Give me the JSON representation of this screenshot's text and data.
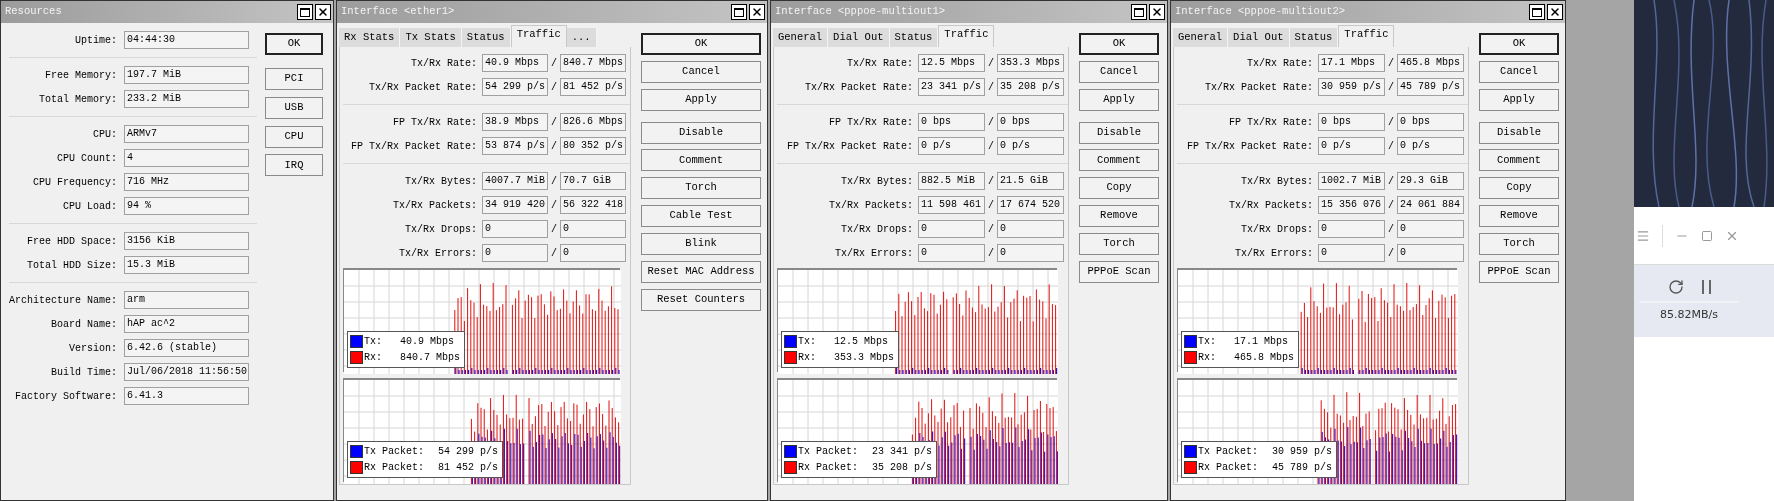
{
  "resources": {
    "title": "Resources",
    "groups": [
      [
        {
          "label": "Uptime:",
          "value": "04:44:30"
        }
      ],
      [
        {
          "label": "Free Memory:",
          "value": "197.7 MiB"
        },
        {
          "label": "Total Memory:",
          "value": "233.2 MiB"
        }
      ],
      [
        {
          "label": "CPU:",
          "value": "ARMv7"
        },
        {
          "label": "CPU Count:",
          "value": "4"
        },
        {
          "label": "CPU Frequency:",
          "value": "716 MHz"
        },
        {
          "label": "CPU Load:",
          "value": "94 %"
        }
      ],
      [
        {
          "label": "Free HDD Space:",
          "value": "3156 KiB"
        },
        {
          "label": "Total HDD Size:",
          "value": "15.3 MiB"
        }
      ],
      [
        {
          "label": "Architecture Name:",
          "value": "arm"
        },
        {
          "label": "Board Name:",
          "value": "hAP ac^2"
        },
        {
          "label": "Version:",
          "value": "6.42.6 (stable)"
        },
        {
          "label": "Build Time:",
          "value": "Jul/06/2018 11:56:50"
        },
        {
          "label": "Factory Software:",
          "value": "6.41.3"
        }
      ]
    ],
    "buttons": [
      {
        "label": "OK",
        "default": true
      },
      {
        "label": "PCI",
        "default": false
      },
      {
        "label": "USB",
        "default": false
      },
      {
        "label": "CPU",
        "default": false
      },
      {
        "label": "IRQ",
        "default": false
      }
    ]
  },
  "interfaces": [
    {
      "title": "Interface <ether1>",
      "tabs": [
        {
          "label": "Rx Stats",
          "selected": false
        },
        {
          "label": "Tx Stats",
          "selected": false
        },
        {
          "label": "Status",
          "selected": false
        },
        {
          "label": "Traffic",
          "selected": true
        },
        {
          "label": "...",
          "selected": false
        }
      ],
      "groups": [
        [
          {
            "label": "Tx/Rx Rate:",
            "tx": "40.9 Mbps",
            "sep": "/",
            "rx": "840.7 Mbps"
          },
          {
            "label": "Tx/Rx Packet Rate:",
            "tx": "54 299 p/s",
            "sep": "/",
            "rx": "81 452 p/s"
          }
        ],
        [
          {
            "label": "FP Tx/Rx Rate:",
            "tx": "38.9 Mbps",
            "sep": "/",
            "rx": "826.6 Mbps"
          },
          {
            "label": "FP Tx/Rx Packet Rate:",
            "tx": "53 874 p/s",
            "sep": "/",
            "rx": "80 352 p/s"
          }
        ],
        [
          {
            "label": "Tx/Rx Bytes:",
            "tx": "4007.7 MiB",
            "sep": "/",
            "rx": "70.7 GiB"
          },
          {
            "label": "Tx/Rx Packets:",
            "tx": "34 919 420",
            "sep": "/",
            "rx": "56 322 418"
          },
          {
            "label": "Tx/Rx Drops:",
            "tx": "0",
            "sep": "/",
            "rx": "0"
          },
          {
            "label": "Tx/Rx Errors:",
            "tx": "0",
            "sep": "/",
            "rx": "0"
          }
        ]
      ],
      "buttons": [
        {
          "label": "OK",
          "default": true
        },
        {
          "label": "Cancel",
          "default": false
        },
        {
          "label": "Apply",
          "default": false
        },
        {
          "label": "Disable",
          "default": false
        },
        {
          "label": "Comment",
          "default": false
        },
        {
          "label": "Torch",
          "default": false
        },
        {
          "label": "Cable Test",
          "default": false
        },
        {
          "label": "Blink",
          "default": false
        },
        {
          "label": "Reset MAC Address",
          "default": false
        },
        {
          "label": "Reset Counters",
          "default": false
        }
      ],
      "rate_graph": {
        "legend": [
          {
            "label": "Tx:",
            "value": "40.9 Mbps",
            "color": "#0000ff"
          },
          {
            "label": "Rx:",
            "value": "840.7 Mbps",
            "color": "#ff0000"
          }
        ]
      },
      "packet_graph": {
        "legend": [
          {
            "label": "Tx Packet:",
            "value": "54 299 p/s",
            "color": "#0000ff"
          },
          {
            "label": "Rx Packet:",
            "value": "81 452 p/s",
            "color": "#ff0000"
          }
        ]
      }
    },
    {
      "title": "Interface <pppoe-multiout1>",
      "tabs": [
        {
          "label": "General",
          "selected": false
        },
        {
          "label": "Dial Out",
          "selected": false
        },
        {
          "label": "Status",
          "selected": false
        },
        {
          "label": "Traffic",
          "selected": true
        }
      ],
      "groups": [
        [
          {
            "label": "Tx/Rx Rate:",
            "tx": "12.5 Mbps",
            "sep": "/",
            "rx": "353.3 Mbps"
          },
          {
            "label": "Tx/Rx Packet Rate:",
            "tx": "23 341 p/s",
            "sep": "/",
            "rx": "35 208 p/s"
          }
        ],
        [
          {
            "label": "FP Tx/Rx Rate:",
            "tx": "0 bps",
            "sep": "/",
            "rx": "0 bps"
          },
          {
            "label": "FP Tx/Rx Packet Rate:",
            "tx": "0 p/s",
            "sep": "/",
            "rx": "0 p/s"
          }
        ],
        [
          {
            "label": "Tx/Rx Bytes:",
            "tx": "882.5 MiB",
            "sep": "/",
            "rx": "21.5 GiB"
          },
          {
            "label": "Tx/Rx Packets:",
            "tx": "11 598 461",
            "sep": "/",
            "rx": "17 674 520"
          },
          {
            "label": "Tx/Rx Drops:",
            "tx": "0",
            "sep": "/",
            "rx": "0"
          },
          {
            "label": "Tx/Rx Errors:",
            "tx": "0",
            "sep": "/",
            "rx": "0"
          }
        ]
      ],
      "buttons": [
        {
          "label": "OK",
          "default": true
        },
        {
          "label": "Cancel",
          "default": false
        },
        {
          "label": "Apply",
          "default": false
        },
        {
          "label": "Disable",
          "default": false
        },
        {
          "label": "Comment",
          "default": false
        },
        {
          "label": "Copy",
          "default": false
        },
        {
          "label": "Remove",
          "default": false
        },
        {
          "label": "Torch",
          "default": false
        },
        {
          "label": "PPPoE Scan",
          "default": false
        }
      ],
      "rate_graph": {
        "legend": [
          {
            "label": "Tx:",
            "value": "12.5 Mbps",
            "color": "#0000ff"
          },
          {
            "label": "Rx:",
            "value": "353.3 Mbps",
            "color": "#ff0000"
          }
        ]
      },
      "packet_graph": {
        "legend": [
          {
            "label": "Tx Packet:",
            "value": "23 341 p/s",
            "color": "#0000ff"
          },
          {
            "label": "Rx Packet:",
            "value": "35 208 p/s",
            "color": "#ff0000"
          }
        ]
      }
    },
    {
      "title": "Interface <pppoe-multiout2>",
      "tabs": [
        {
          "label": "General",
          "selected": false
        },
        {
          "label": "Dial Out",
          "selected": false
        },
        {
          "label": "Status",
          "selected": false
        },
        {
          "label": "Traffic",
          "selected": true
        }
      ],
      "groups": [
        [
          {
            "label": "Tx/Rx Rate:",
            "tx": "17.1 Mbps",
            "sep": "/",
            "rx": "465.8 Mbps"
          },
          {
            "label": "Tx/Rx Packet Rate:",
            "tx": "30 959 p/s",
            "sep": "/",
            "rx": "45 789 p/s"
          }
        ],
        [
          {
            "label": "FP Tx/Rx Rate:",
            "tx": "0 bps",
            "sep": "/",
            "rx": "0 bps"
          },
          {
            "label": "FP Tx/Rx Packet Rate:",
            "tx": "0 p/s",
            "sep": "/",
            "rx": "0 p/s"
          }
        ],
        [
          {
            "label": "Tx/Rx Bytes:",
            "tx": "1002.7 MiB",
            "sep": "/",
            "rx": "29.3 GiB"
          },
          {
            "label": "Tx/Rx Packets:",
            "tx": "15 356 076",
            "sep": "/",
            "rx": "24 061 884"
          },
          {
            "label": "Tx/Rx Drops:",
            "tx": "0",
            "sep": "/",
            "rx": "0"
          },
          {
            "label": "Tx/Rx Errors:",
            "tx": "0",
            "sep": "/",
            "rx": "0"
          }
        ]
      ],
      "buttons": [
        {
          "label": "OK",
          "default": true
        },
        {
          "label": "Cancel",
          "default": false
        },
        {
          "label": "Apply",
          "default": false
        },
        {
          "label": "Disable",
          "default": false
        },
        {
          "label": "Comment",
          "default": false
        },
        {
          "label": "Copy",
          "default": false
        },
        {
          "label": "Remove",
          "default": false
        },
        {
          "label": "Torch",
          "default": false
        },
        {
          "label": "PPPoE Scan",
          "default": false
        }
      ],
      "rate_graph": {
        "legend": [
          {
            "label": "Tx:",
            "value": "17.1 Mbps",
            "color": "#0000ff"
          },
          {
            "label": "Rx:",
            "value": "465.8 Mbps",
            "color": "#ff0000"
          }
        ]
      },
      "packet_graph": {
        "legend": [
          {
            "label": "Tx Packet:",
            "value": "30 959 p/s",
            "color": "#0000ff"
          },
          {
            "label": "Rx Packet:",
            "value": "45 789 p/s",
            "color": "#ff0000"
          }
        ]
      }
    }
  ],
  "download_app": {
    "speed": "85.82MB/s"
  }
}
